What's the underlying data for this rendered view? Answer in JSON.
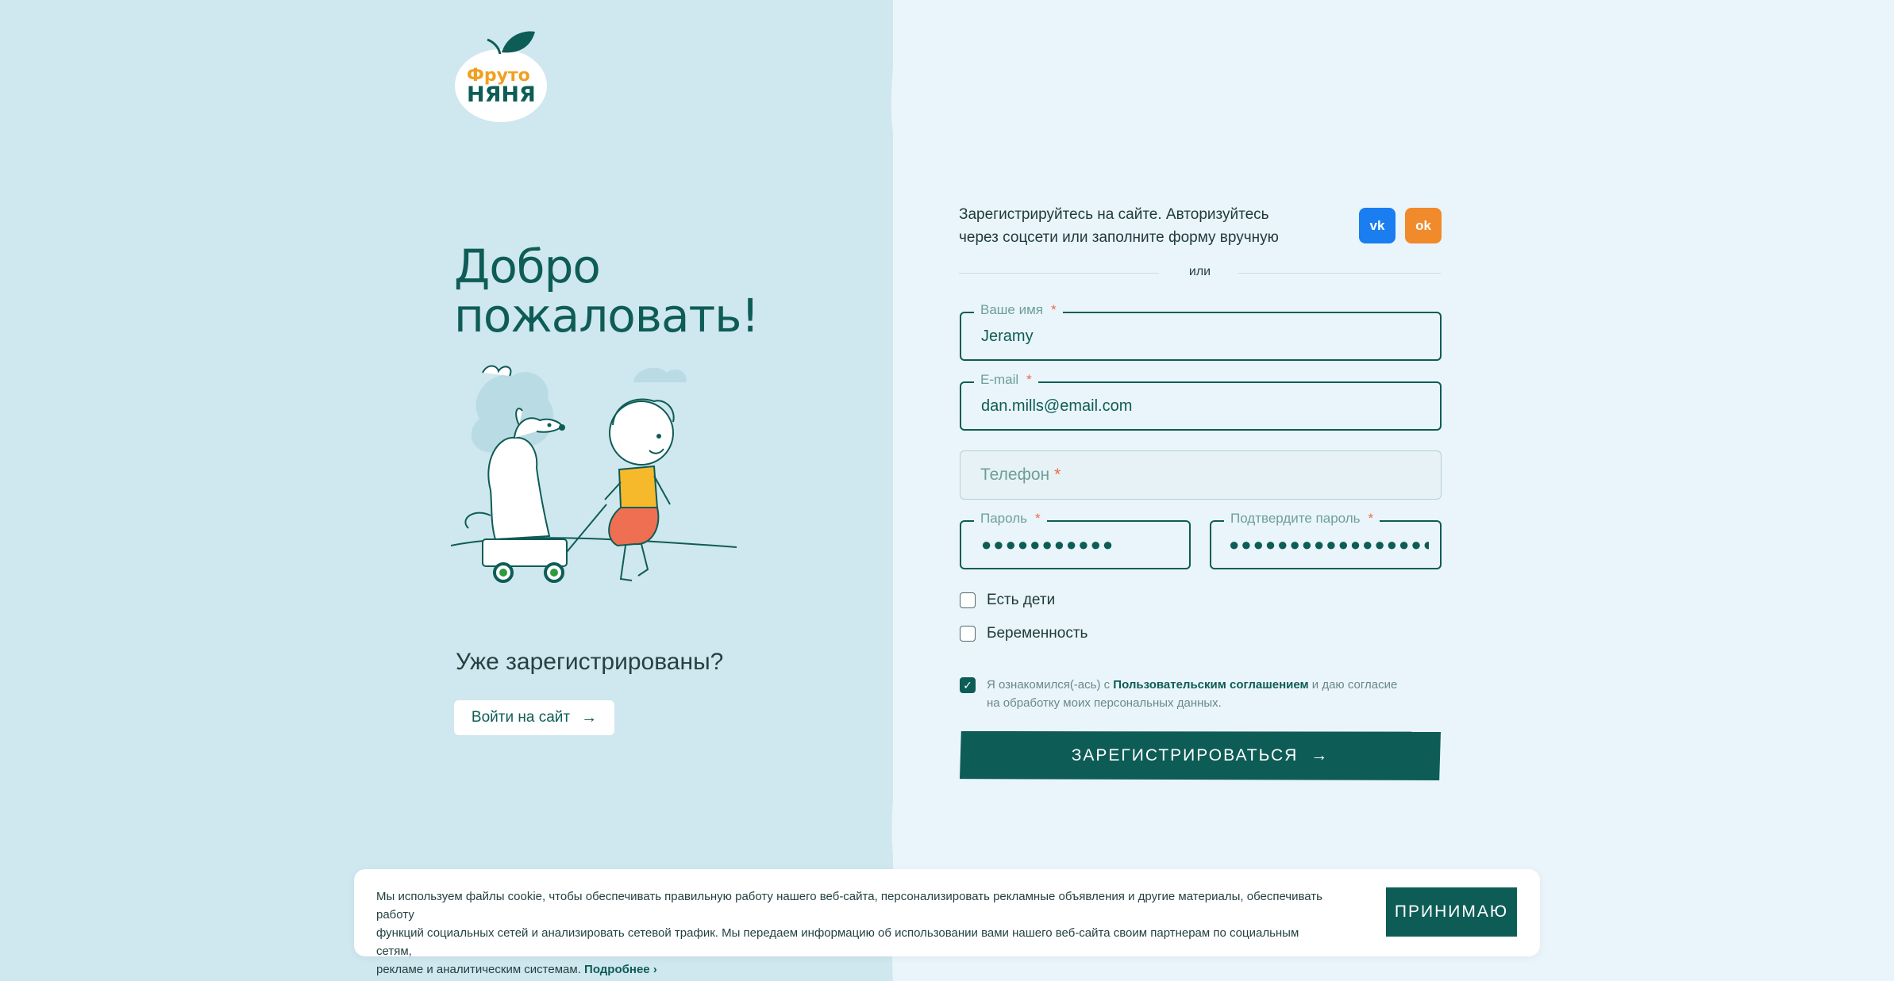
{
  "logo": {
    "line1": "Фруто",
    "line2": "НЯНЯ"
  },
  "welcome": {
    "title_line1": "Добро",
    "title_line2": "пожаловать!"
  },
  "already": {
    "text": "Уже зарегистрированы?",
    "login_label": "Войти на сайт",
    "login_arrow": "→"
  },
  "form": {
    "intro_line1": "Зарегистрируйтесь на сайте. Авторизуйтесь",
    "intro_line2": "через соцсети или заполните форму вручную",
    "social": {
      "vk": "vk",
      "ok": "ok"
    },
    "or": "или",
    "required_mark": "*",
    "name": {
      "label": "Ваше имя",
      "value": "Jeramy"
    },
    "email": {
      "label": "E-mail",
      "value": "dan.mills@email.com"
    },
    "phone": {
      "placeholder": "Телефон"
    },
    "password": {
      "label": "Пароль",
      "masked": "●●●●●●●●●●●"
    },
    "confirm": {
      "label": "Подтвердите пароль",
      "masked": "●●●●●●●●●●●●●●●●●●●●"
    },
    "kids_label": "Есть дети",
    "pregnancy_label": "Беременность",
    "agree": {
      "before": "Я ознакомился(-ась) с ",
      "link": "Пользовательским соглашением",
      "after": " и даю согласие",
      "line2": "на обработку моих персональных данных."
    },
    "register_label": "ЗАРЕГИСТРИРОВАТЬСЯ",
    "register_arrow": "→"
  },
  "cookie": {
    "line1": "Мы используем файлы cookie, чтобы обеспечивать правильную работу нашего веб-сайта, персонализировать рекламные объявления и другие материалы, обеспечивать работу",
    "line2": "функций социальных сетей и анализировать сетевой трафик. Мы передаем информацию об использовании вами нашего веб-сайта своим партнерам по социальным сетям,",
    "line3": "рекламе и аналитическим системам. ",
    "more": "Подробнее  ›",
    "accept": "ПРИНИМАЮ"
  },
  "colors": {
    "brand": "#0e5c56",
    "left_bg": "#cfe7ee",
    "right_bg": "#e9f5fa",
    "required": "#ef6a4a",
    "vk": "#1a7df0",
    "ok": "#f08a2a"
  }
}
